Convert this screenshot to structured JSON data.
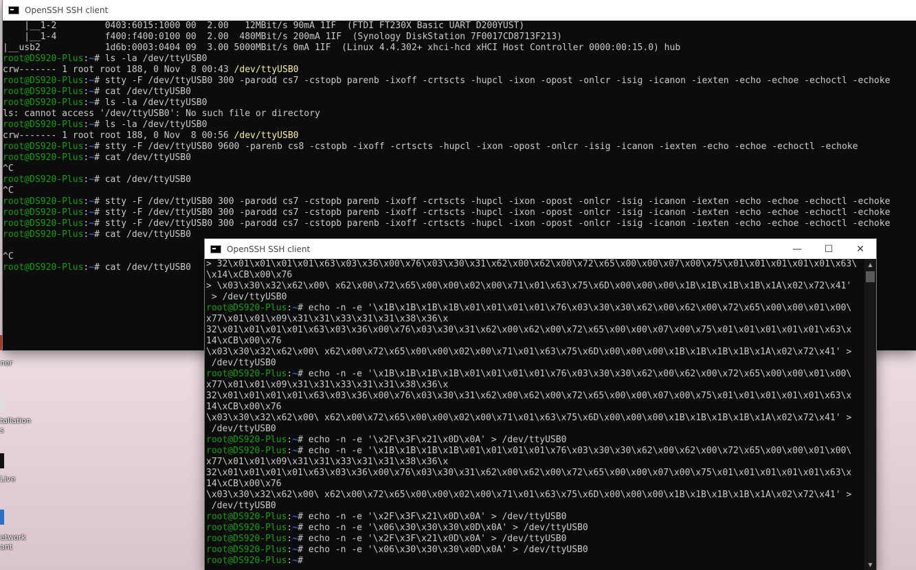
{
  "desktop": {
    "icons": [
      {
        "label": "ner"
      },
      {
        "label": "tallation\ns"
      },
      {
        "label": "Live"
      },
      {
        "label": "etwork\nant"
      }
    ]
  },
  "window1": {
    "title": "OpenSSH SSH client",
    "lines": [
      "    |__1-2         0403:6015:1000 00  2.00   12MBit/s 90mA 1IF  (FTDI FT230X Basic UART D200YUST)",
      "    |__1-4         f400:f400:0100 00  2.00  480MBit/s 200mA 1IF  (Synology DiskStation 7F0017CD8713F213)",
      "|__usb2            1d6b:0003:0404 09  3.00 5000MBit/s 0mA 1IF  (Linux 4.4.302+ xhci-hcd xHCI Host Controller 0000:00:15.0) hub",
      "$ls -la /dev/ttyUSB0",
      "@crw------- 1 root root 188, 0 Nov  8 00:43 |/dev/ttyUSB0",
      "$stty -F /dev/ttyUSB0 300 -parodd cs7 -cstopb parenb -ixoff -crtscts -hupcl -ixon -opost -onlcr -isig -icanon -iexten -echo -echoe -echoctl -echoke",
      "$cat /dev/ttyUSB0",
      "$ls -la /dev/ttyUSB0",
      "ls: cannot access '/dev/ttyUSB0': No such file or directory",
      "$ls -la /dev/ttyUSB0",
      "@crw------- 1 root root 188, 0 Nov  8 00:56 |/dev/ttyUSB0",
      "$stty -F /dev/ttyUSB0 9600 -parenb cs8 -cstopb -ixoff -crtscts -hupcl -ixon -opost -onlcr -isig -icanon -iexten -echo -echoe -echoctl -echoke",
      "$cat /dev/ttyUSB0",
      "^C",
      "$cat /dev/ttyUSB0",
      "^C",
      "$stty -F /dev/ttyUSB0 300 -parodd cs7 -cstopb parenb -ixoff -crtscts -hupcl -ixon -opost -onlcr -isig -icanon -iexten -echo -echoe -echoctl -echoke",
      "$stty -F /dev/ttyUSB0 300 -parodd cs7 -cstopb parenb -ixoff -crtscts -hupcl -ixon -opost -onlcr -isig -icanon -iexten -echo -echoe -echoctl -echoke",
      "$stty -F /dev/ttyUSB0 300 -parodd cs7 -cstopb parenb -ixoff -crtscts -hupcl -ixon -opost -onlcr -isig -icanon -iexten -echo -echoe -echoctl -echoke",
      "$cat /dev/ttyUSB0",
      "",
      "^C",
      "$cat /dev/ttyUSB0"
    ]
  },
  "window2": {
    "title": "OpenSSH SSH client",
    "lines": [
      "> 32\\x01\\x01\\x01\\x01\\x63\\x03\\x36\\x00\\x76\\x03\\x30\\x31\\x62\\x00\\x62\\x00\\x72\\x65\\x00\\x00\\x07\\x00\\x75\\x01\\x01\\x01\\x01\\x01\\x63\\",
      "\\x14\\xCB\\x00\\x76",
      "> \\x03\\x30\\x32\\x62\\x00\\ x62\\x00\\x72\\x65\\x00\\x00\\x02\\x00\\x71\\x01\\x63\\x75\\x6D\\x00\\x00\\x00\\x1B\\x1B\\x1B\\x1B\\x1A\\x02\\x72\\x41'",
      " > /dev/ttyUSB0",
      "$echo -n -e '\\x1B\\x1B\\x1B\\x1B\\x01\\x01\\x01\\x01\\x76\\x03\\x30\\x30\\x62\\x00\\x62\\x00\\x72\\x65\\x00\\x00\\x01\\x00\\",
      "x77\\x01\\x01\\x09\\x31\\x31\\x33\\x31\\x31\\x38\\x36\\x",
      "32\\x01\\x01\\x01\\x01\\x63\\x03\\x36\\x00\\x76\\x03\\x30\\x31\\x62\\x00\\x62\\x00\\x72\\x65\\x00\\x00\\x07\\x00\\x75\\x01\\x01\\x01\\x01\\x01\\x63\\x",
      "14\\xCB\\x00\\x76",
      "\\x03\\x30\\x32\\x62\\x00\\ x62\\x00\\x72\\x65\\x00\\x00\\x02\\x00\\x71\\x01\\x63\\x75\\x6D\\x00\\x00\\x00\\x1B\\x1B\\x1B\\x1B\\x1A\\x02\\x72\\x41' >",
      " /dev/ttyUSB0",
      "$echo -n -e '\\x1B\\x1B\\x1B\\x1B\\x01\\x01\\x01\\x01\\x76\\x03\\x30\\x30\\x62\\x00\\x62\\x00\\x72\\x65\\x00\\x00\\x01\\x00\\",
      "x77\\x01\\x01\\x09\\x31\\x31\\x33\\x31\\x31\\x38\\x36\\x",
      "32\\x01\\x01\\x01\\x01\\x63\\x03\\x36\\x00\\x76\\x03\\x30\\x31\\x62\\x00\\x62\\x00\\x72\\x65\\x00\\x00\\x07\\x00\\x75\\x01\\x01\\x01\\x01\\x01\\x63\\x",
      "14\\xCB\\x00\\x76",
      "\\x03\\x30\\x32\\x62\\x00\\ x62\\x00\\x72\\x65\\x00\\x00\\x02\\x00\\x71\\x01\\x63\\x75\\x6D\\x00\\x00\\x00\\x1B\\x1B\\x1B\\x1B\\x1A\\x02\\x72\\x41' >",
      " /dev/ttyUSB0",
      "$echo -n -e '\\x2F\\x3F\\x21\\x0D\\x0A' > /dev/ttyUSB0",
      "$echo -n -e '\\x1B\\x1B\\x1B\\x1B\\x01\\x01\\x01\\x01\\x76\\x03\\x30\\x30\\x62\\x00\\x62\\x00\\x72\\x65\\x00\\x00\\x01\\x00\\",
      "x77\\x01\\x01\\x09\\x31\\x31\\x33\\x31\\x31\\x38\\x36\\x",
      "32\\x01\\x01\\x01\\x01\\x63\\x03\\x36\\x00\\x76\\x03\\x30\\x31\\x62\\x00\\x62\\x00\\x72\\x65\\x00\\x00\\x07\\x00\\x75\\x01\\x01\\x01\\x01\\x01\\x63\\x",
      "14\\xCB\\x00\\x76",
      "\\x03\\x30\\x32\\x62\\x00\\ x62\\x00\\x72\\x65\\x00\\x00\\x02\\x00\\x71\\x01\\x63\\x75\\x6D\\x00\\x00\\x00\\x1B\\x1B\\x1B\\x1B\\x1A\\x02\\x72\\x41' >",
      " /dev/ttyUSB0",
      "$echo -n -e '\\x2F\\x3F\\x21\\x0D\\x0A' > /dev/ttyUSB0",
      "$echo -n -e '\\x06\\x30\\x30\\x30\\x0D\\x0A' > /dev/ttyUSB0",
      "$echo -n -e '\\x2F\\x3F\\x21\\x0D\\x0A' > /dev/ttyUSB0",
      "$echo -n -e '\\x06\\x30\\x30\\x30\\x0D\\x0A' > /dev/ttyUSB0",
      "$"
    ]
  },
  "prompt": {
    "user": "root@DS920-Plus",
    "sep": ":",
    "path": "~",
    "suffix": "# "
  },
  "colors": {
    "prompt_user": "#13a10e",
    "prompt_path": "#3b78ff",
    "file_highlight": "#f9f1a5",
    "terminal_bg": "#0c0c0c",
    "terminal_fg": "#cccccc"
  },
  "icons": {
    "terminal": "cmd-icon",
    "minimize": "minimize-icon",
    "maximize": "maximize-icon",
    "close": "close-icon"
  }
}
